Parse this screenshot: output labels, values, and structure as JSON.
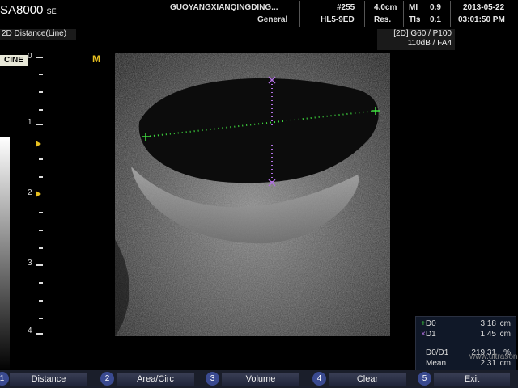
{
  "header": {
    "logo_brand": "SA",
    "logo_model": "8000",
    "logo_suffix": "SE",
    "hospital": "GUOYANGXIANQINGDING...",
    "preset": "General",
    "frame": "#255",
    "probe": "HL5-9ED",
    "depth": "4.0cm",
    "res_label": "Res.",
    "mi_label": "MI",
    "mi_value": "0.9",
    "tis_label": "TIs",
    "tis_value": "0.1",
    "date": "2013-05-22",
    "time": "03:01:50 PM"
  },
  "mode": {
    "label": "2D Distance(Line)",
    "params_line1": "[2D] G60 / P100",
    "params_line2": "110dB / FA4",
    "cine": "CINE",
    "orientation_marker": "M"
  },
  "depth_scale": {
    "labels": [
      "0",
      "1",
      "2",
      "3",
      "4"
    ]
  },
  "measurements": {
    "d0_label": "D0",
    "d0_value": "3.18",
    "d0_unit": "cm",
    "d1_label": "D1",
    "d1_value": "1.45",
    "d1_unit": "cm",
    "ratio_label": "D0/D1",
    "ratio_value": "219.31",
    "ratio_unit": "%",
    "mean_label": "Mean",
    "mean_value": "2.31",
    "mean_unit": "cm",
    "d0_color": "#40e040",
    "d1_color": "#b070e0"
  },
  "softkeys": [
    {
      "num": "1",
      "label": "Distance"
    },
    {
      "num": "2",
      "label": "Area/Circ"
    },
    {
      "num": "3",
      "label": "Volume"
    },
    {
      "num": "4",
      "label": "Clear"
    },
    {
      "num": "5",
      "label": "Exit"
    }
  ],
  "watermark": "www.ultrasonic.com"
}
